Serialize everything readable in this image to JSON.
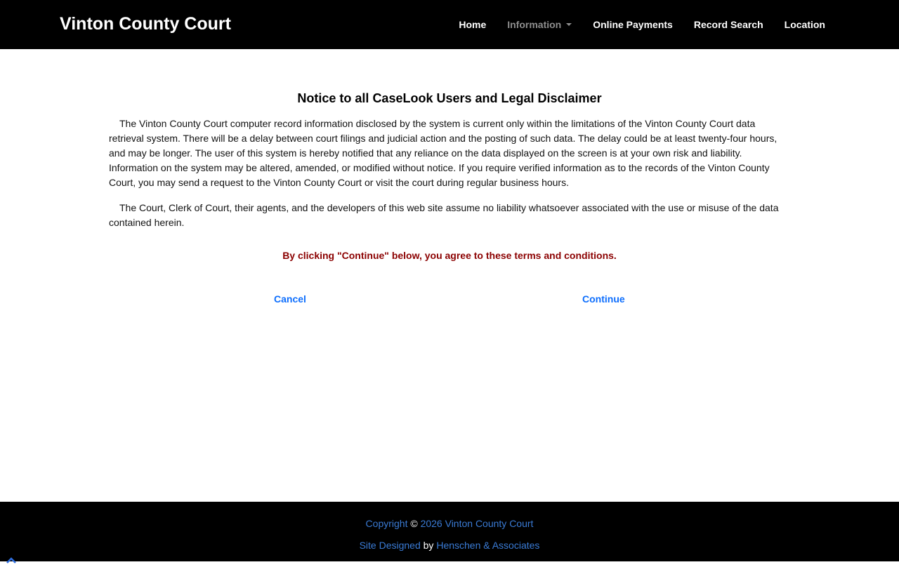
{
  "header": {
    "brand": "Vinton County Court",
    "nav": [
      {
        "label": "Home"
      },
      {
        "label": "Information"
      },
      {
        "label": "Online Payments"
      },
      {
        "label": "Record Search"
      },
      {
        "label": "Location"
      }
    ]
  },
  "notice": {
    "title": "Notice to all CaseLook Users and Legal Disclaimer",
    "paragraph1": "The Vinton County Court computer record information disclosed by the system is current only within the limitations of the Vinton County Court data retrieval system. There will be a delay between court filings and judicial action and the posting of such data. The delay could be at least twenty-four hours, and may be longer. The user of this system is hereby notified that any reliance on the data displayed on the screen is at your own risk and liability. Information on the system may be altered, amended, or modified without notice. If you require verified information as to the records of the Vinton County Court, you may send a request to the Vinton County Court or visit the court during regular business hours.",
    "paragraph2": "The Court, Clerk of Court, their agents, and the developers of this web site assume no liability whatsoever associated with the use or misuse of the data contained herein.",
    "agreement": "By clicking \"Continue\" below, you agree to these terms and conditions."
  },
  "actions": {
    "cancel": "Cancel",
    "continue": "Continue"
  },
  "footer": {
    "copyright_label": "Copyright",
    "copyright_symbol": "©",
    "copyright_text": "2026 Vinton County Court",
    "designed_label": "Site Designed",
    "by": "by",
    "designer": "Henschen & Associates"
  },
  "colors": {
    "navbar_bg": "#000000",
    "link_blue": "#0d6efd",
    "agreement_red": "#8b0000",
    "nav_muted": "#8e8e8e"
  },
  "icons": {
    "back_to_top": "chevron-up-icon"
  }
}
